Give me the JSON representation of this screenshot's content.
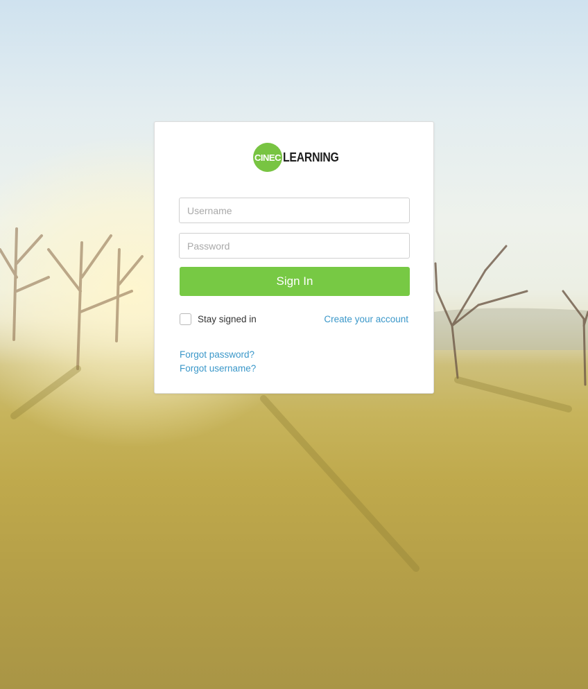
{
  "brand": {
    "badge_text": "CINEC",
    "name": "LEARNING",
    "color": "#78c442"
  },
  "form": {
    "username_placeholder": "Username",
    "password_placeholder": "Password",
    "sign_in_label": "Sign In",
    "stay_signed_in_label": "Stay signed in",
    "stay_signed_in_checked": false,
    "create_account_label": "Create your account",
    "forgot_password_label": "Forgot password?",
    "forgot_username_label": "Forgot username?"
  },
  "colors": {
    "accent": "#77c944",
    "link": "#3a97c9"
  }
}
